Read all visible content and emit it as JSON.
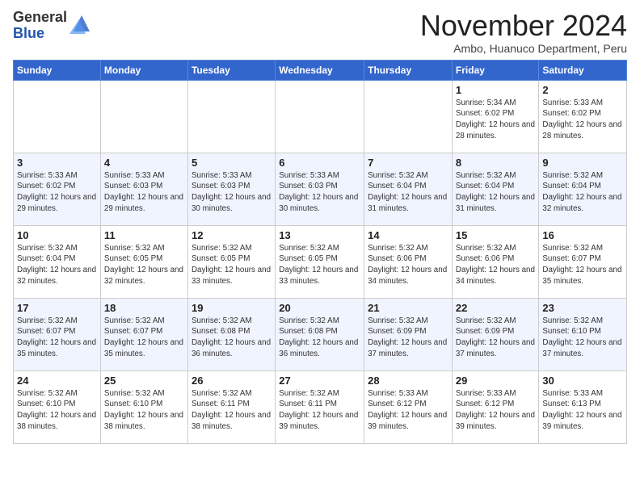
{
  "logo": {
    "general": "General",
    "blue": "Blue"
  },
  "header": {
    "month": "November 2024",
    "location": "Ambo, Huanuco Department, Peru"
  },
  "weekdays": [
    "Sunday",
    "Monday",
    "Tuesday",
    "Wednesday",
    "Thursday",
    "Friday",
    "Saturday"
  ],
  "weeks": [
    [
      {
        "day": "",
        "info": ""
      },
      {
        "day": "",
        "info": ""
      },
      {
        "day": "",
        "info": ""
      },
      {
        "day": "",
        "info": ""
      },
      {
        "day": "",
        "info": ""
      },
      {
        "day": "1",
        "info": "Sunrise: 5:34 AM\nSunset: 6:02 PM\nDaylight: 12 hours and 28 minutes."
      },
      {
        "day": "2",
        "info": "Sunrise: 5:33 AM\nSunset: 6:02 PM\nDaylight: 12 hours and 28 minutes."
      }
    ],
    [
      {
        "day": "3",
        "info": "Sunrise: 5:33 AM\nSunset: 6:02 PM\nDaylight: 12 hours and 29 minutes."
      },
      {
        "day": "4",
        "info": "Sunrise: 5:33 AM\nSunset: 6:03 PM\nDaylight: 12 hours and 29 minutes."
      },
      {
        "day": "5",
        "info": "Sunrise: 5:33 AM\nSunset: 6:03 PM\nDaylight: 12 hours and 30 minutes."
      },
      {
        "day": "6",
        "info": "Sunrise: 5:33 AM\nSunset: 6:03 PM\nDaylight: 12 hours and 30 minutes."
      },
      {
        "day": "7",
        "info": "Sunrise: 5:32 AM\nSunset: 6:04 PM\nDaylight: 12 hours and 31 minutes."
      },
      {
        "day": "8",
        "info": "Sunrise: 5:32 AM\nSunset: 6:04 PM\nDaylight: 12 hours and 31 minutes."
      },
      {
        "day": "9",
        "info": "Sunrise: 5:32 AM\nSunset: 6:04 PM\nDaylight: 12 hours and 32 minutes."
      }
    ],
    [
      {
        "day": "10",
        "info": "Sunrise: 5:32 AM\nSunset: 6:04 PM\nDaylight: 12 hours and 32 minutes."
      },
      {
        "day": "11",
        "info": "Sunrise: 5:32 AM\nSunset: 6:05 PM\nDaylight: 12 hours and 32 minutes."
      },
      {
        "day": "12",
        "info": "Sunrise: 5:32 AM\nSunset: 6:05 PM\nDaylight: 12 hours and 33 minutes."
      },
      {
        "day": "13",
        "info": "Sunrise: 5:32 AM\nSunset: 6:05 PM\nDaylight: 12 hours and 33 minutes."
      },
      {
        "day": "14",
        "info": "Sunrise: 5:32 AM\nSunset: 6:06 PM\nDaylight: 12 hours and 34 minutes."
      },
      {
        "day": "15",
        "info": "Sunrise: 5:32 AM\nSunset: 6:06 PM\nDaylight: 12 hours and 34 minutes."
      },
      {
        "day": "16",
        "info": "Sunrise: 5:32 AM\nSunset: 6:07 PM\nDaylight: 12 hours and 35 minutes."
      }
    ],
    [
      {
        "day": "17",
        "info": "Sunrise: 5:32 AM\nSunset: 6:07 PM\nDaylight: 12 hours and 35 minutes."
      },
      {
        "day": "18",
        "info": "Sunrise: 5:32 AM\nSunset: 6:07 PM\nDaylight: 12 hours and 35 minutes."
      },
      {
        "day": "19",
        "info": "Sunrise: 5:32 AM\nSunset: 6:08 PM\nDaylight: 12 hours and 36 minutes."
      },
      {
        "day": "20",
        "info": "Sunrise: 5:32 AM\nSunset: 6:08 PM\nDaylight: 12 hours and 36 minutes."
      },
      {
        "day": "21",
        "info": "Sunrise: 5:32 AM\nSunset: 6:09 PM\nDaylight: 12 hours and 37 minutes."
      },
      {
        "day": "22",
        "info": "Sunrise: 5:32 AM\nSunset: 6:09 PM\nDaylight: 12 hours and 37 minutes."
      },
      {
        "day": "23",
        "info": "Sunrise: 5:32 AM\nSunset: 6:10 PM\nDaylight: 12 hours and 37 minutes."
      }
    ],
    [
      {
        "day": "24",
        "info": "Sunrise: 5:32 AM\nSunset: 6:10 PM\nDaylight: 12 hours and 38 minutes."
      },
      {
        "day": "25",
        "info": "Sunrise: 5:32 AM\nSunset: 6:10 PM\nDaylight: 12 hours and 38 minutes."
      },
      {
        "day": "26",
        "info": "Sunrise: 5:32 AM\nSunset: 6:11 PM\nDaylight: 12 hours and 38 minutes."
      },
      {
        "day": "27",
        "info": "Sunrise: 5:32 AM\nSunset: 6:11 PM\nDaylight: 12 hours and 39 minutes."
      },
      {
        "day": "28",
        "info": "Sunrise: 5:33 AM\nSunset: 6:12 PM\nDaylight: 12 hours and 39 minutes."
      },
      {
        "day": "29",
        "info": "Sunrise: 5:33 AM\nSunset: 6:12 PM\nDaylight: 12 hours and 39 minutes."
      },
      {
        "day": "30",
        "info": "Sunrise: 5:33 AM\nSunset: 6:13 PM\nDaylight: 12 hours and 39 minutes."
      }
    ]
  ]
}
